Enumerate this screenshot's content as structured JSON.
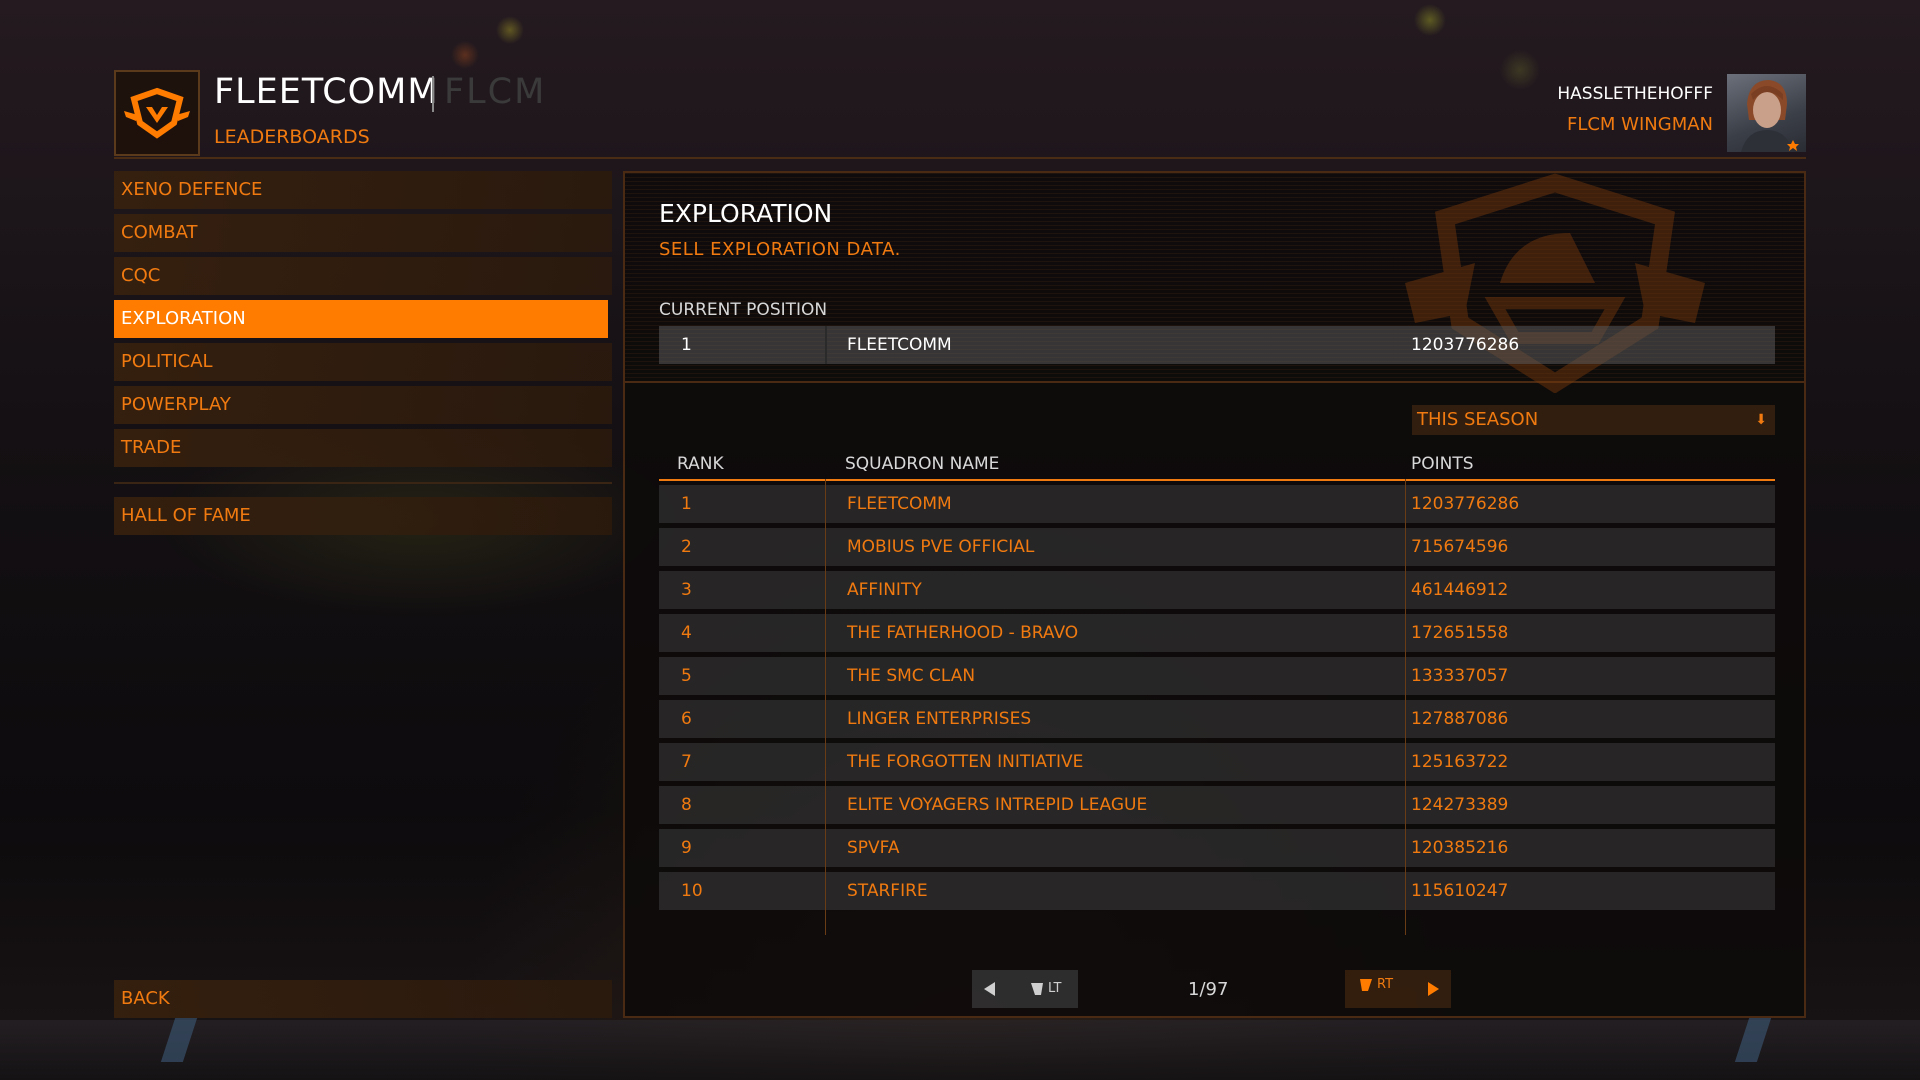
{
  "header": {
    "squadron_name": "FLEETCOMM",
    "squadron_tag": "FLCM",
    "section": "LEADERBOARDS",
    "commander_name": "HASSLETHEHOFFF",
    "commander_rank": "FLCM WINGMAN",
    "accent_color": "#ff7c00"
  },
  "sidebar": {
    "items": [
      {
        "label": "XENO DEFENCE",
        "active": false
      },
      {
        "label": "COMBAT",
        "active": false
      },
      {
        "label": "CQC",
        "active": false
      },
      {
        "label": "EXPLORATION",
        "active": true
      },
      {
        "label": "POLITICAL",
        "active": false
      },
      {
        "label": "POWERPLAY",
        "active": false
      },
      {
        "label": "TRADE",
        "active": false
      }
    ],
    "hall_of_fame": "HALL OF FAME",
    "back": "BACK"
  },
  "main": {
    "title": "EXPLORATION",
    "description": "SELL EXPLORATION DATA.",
    "current_position_label": "CURRENT POSITION",
    "current": {
      "rank": "1",
      "name": "FLEETCOMM",
      "points": "1203776286"
    },
    "filter": "THIS SEASON",
    "columns": {
      "rank": "RANK",
      "name": "SQUADRON NAME",
      "points": "POINTS"
    },
    "rows": [
      {
        "rank": "1",
        "name": "FLEETCOMM",
        "points": "1203776286"
      },
      {
        "rank": "2",
        "name": "MOBIUS PVE OFFICIAL",
        "points": "715674596"
      },
      {
        "rank": "3",
        "name": "AFFINITY",
        "points": "461446912"
      },
      {
        "rank": "4",
        "name": "THE FATHERHOOD - BRAVO",
        "points": "172651558"
      },
      {
        "rank": "5",
        "name": "THE SMC CLAN",
        "points": "133337057"
      },
      {
        "rank": "6",
        "name": "LINGER ENTERPRISES",
        "points": "127887086"
      },
      {
        "rank": "7",
        "name": "THE FORGOTTEN INITIATIVE",
        "points": "125163722"
      },
      {
        "rank": "8",
        "name": "ELITE VOYAGERS INTREPID LEAGUE",
        "points": "124273389"
      },
      {
        "rank": "9",
        "name": "SPVFA",
        "points": "120385216"
      },
      {
        "rank": "10",
        "name": "STARFIRE",
        "points": "115610247"
      }
    ],
    "pager": {
      "prev_label": "LT",
      "next_label": "RT",
      "page_text": "1/97"
    }
  }
}
